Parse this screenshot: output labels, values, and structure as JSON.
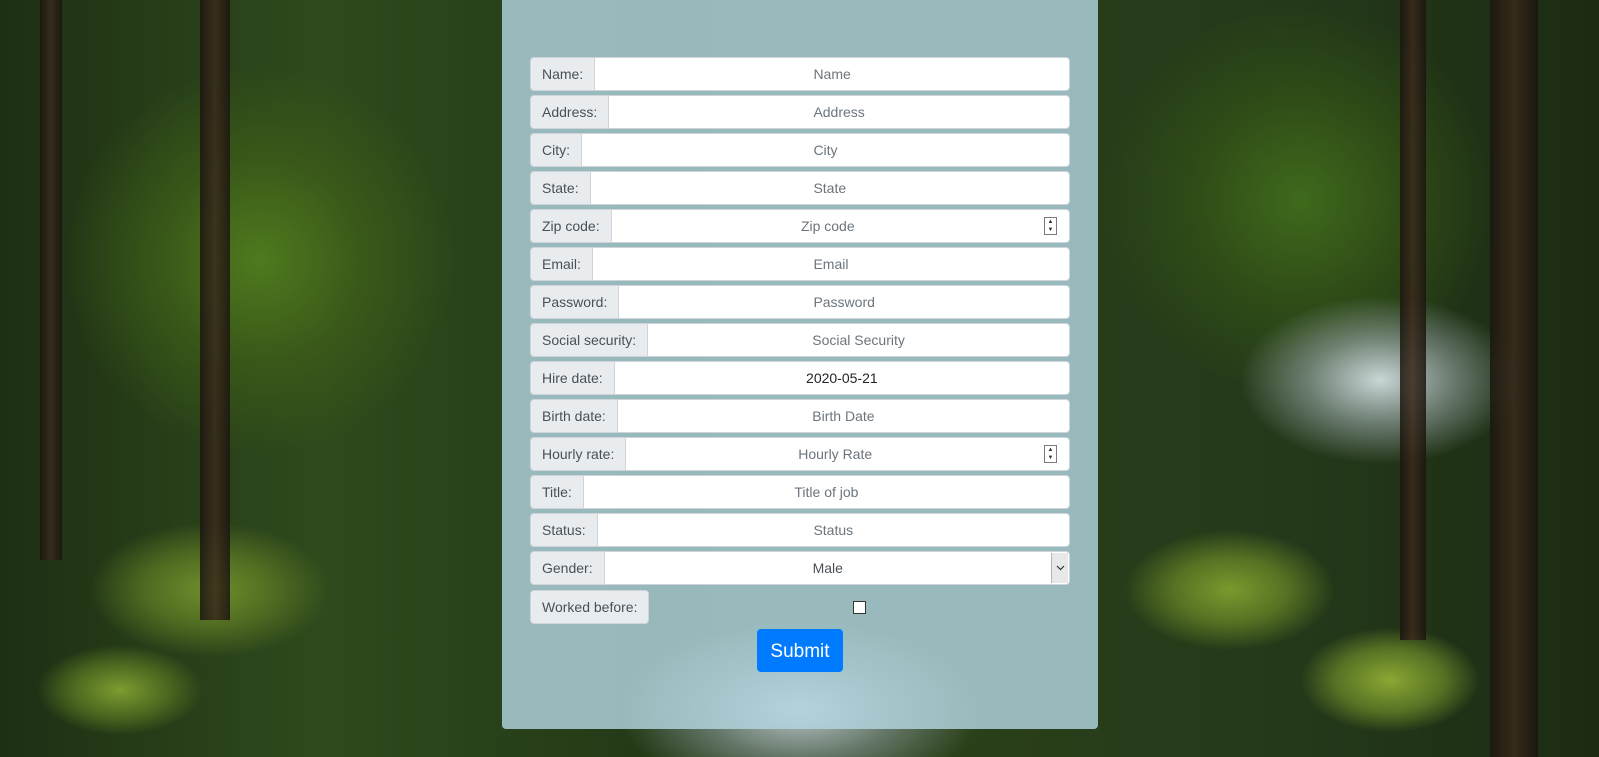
{
  "form": {
    "fields": [
      {
        "label": "Name:",
        "placeholder": "Name",
        "value": ""
      },
      {
        "label": "Address:",
        "placeholder": "Address",
        "value": ""
      },
      {
        "label": "City:",
        "placeholder": "City",
        "value": ""
      },
      {
        "label": "State:",
        "placeholder": "State",
        "value": ""
      },
      {
        "label": "Zip code:",
        "placeholder": "Zip code",
        "value": ""
      },
      {
        "label": "Email:",
        "placeholder": "Email",
        "value": ""
      },
      {
        "label": "Password:",
        "placeholder": "Password",
        "value": ""
      },
      {
        "label": "Social security:",
        "placeholder": "Social Security",
        "value": ""
      },
      {
        "label": "Hire date:",
        "placeholder": "",
        "value": "2020-05-21"
      },
      {
        "label": "Birth date:",
        "placeholder": "Birth Date",
        "value": ""
      },
      {
        "label": "Hourly rate:",
        "placeholder": "Hourly Rate",
        "value": ""
      },
      {
        "label": "Title:",
        "placeholder": "Title of job",
        "value": ""
      },
      {
        "label": "Status:",
        "placeholder": "Status",
        "value": ""
      }
    ],
    "gender": {
      "label": "Gender:",
      "selected": "Male",
      "icon": "chevron-down-icon"
    },
    "worked_before": {
      "label": "Worked before:",
      "checked": false
    },
    "submit_label": "Submit"
  },
  "colors": {
    "panel": "#b2d6e0",
    "submit": "#007bff",
    "label_bg": "#e9ecef"
  }
}
